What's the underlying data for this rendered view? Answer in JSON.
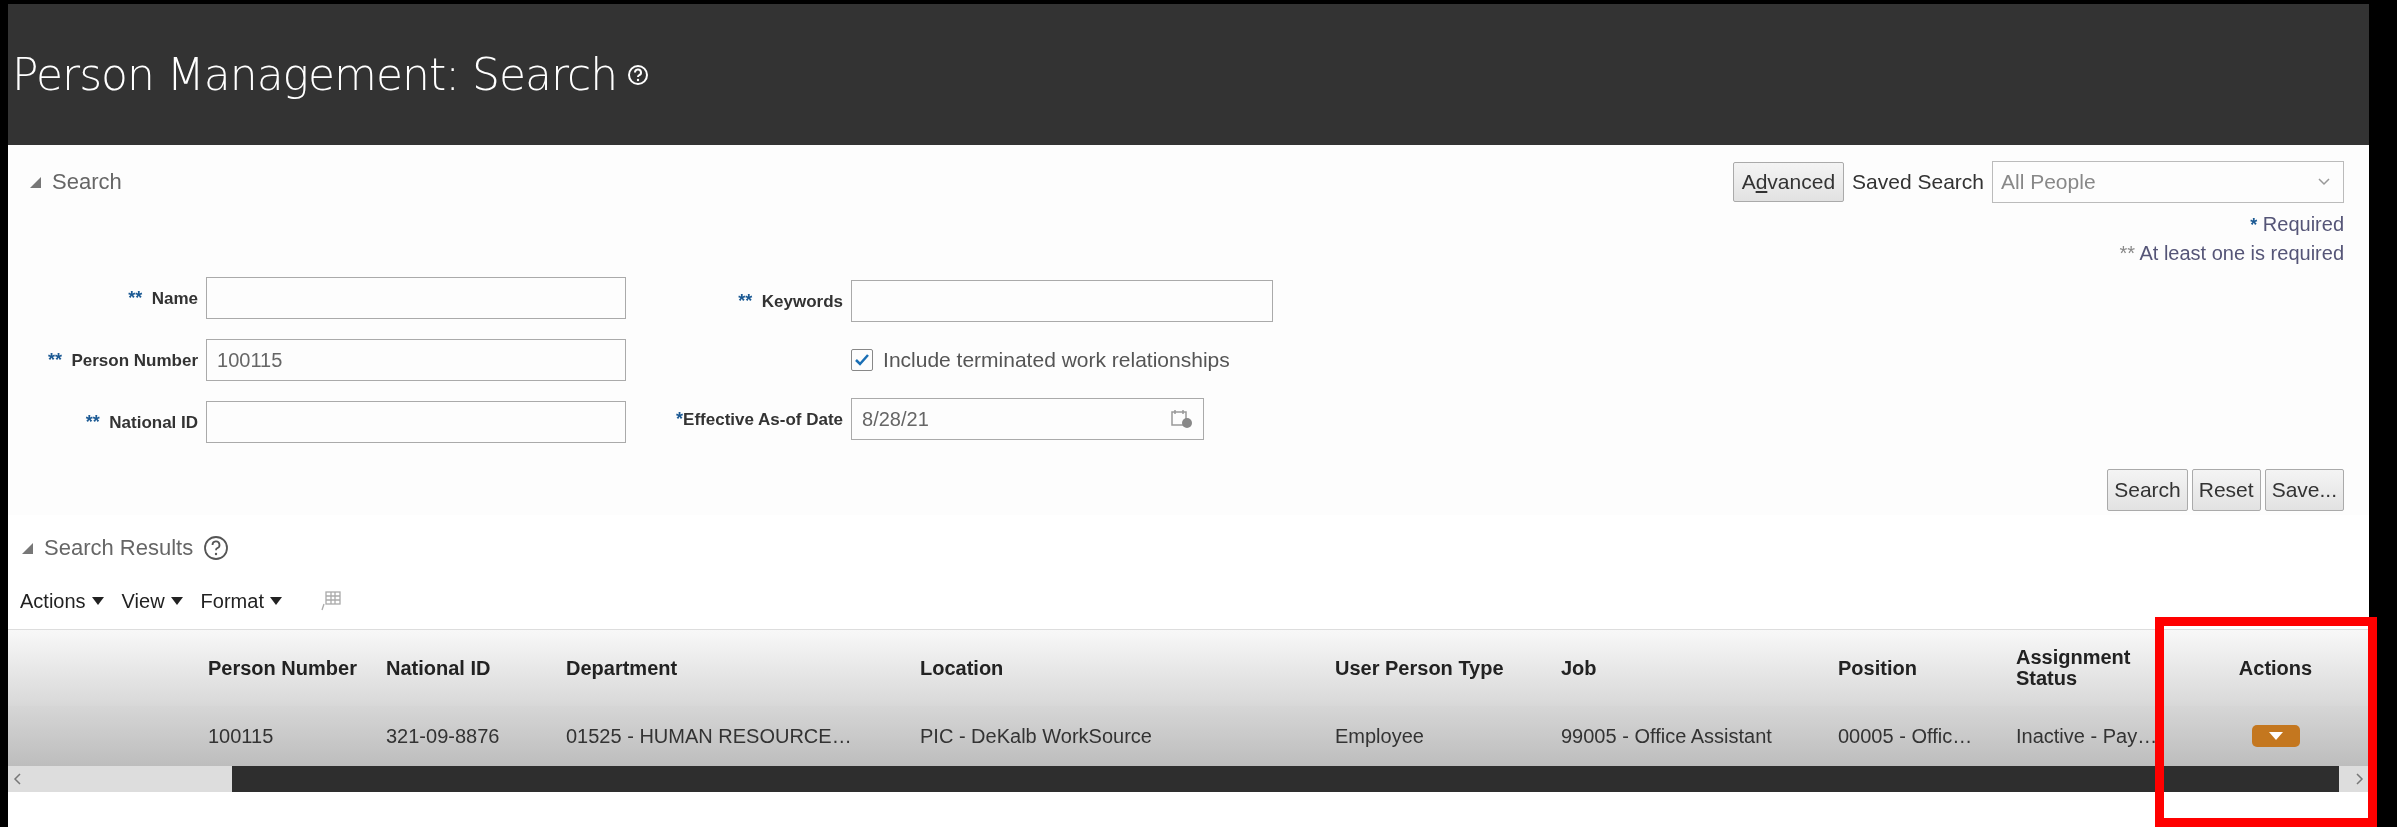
{
  "header": {
    "title": "Person Management: Search"
  },
  "search_panel": {
    "heading": "Search",
    "expanded": true,
    "advanced_button": {
      "label": "Advanced"
    },
    "saved_search": {
      "label": "Saved Search",
      "value": "All People"
    },
    "required_notes": [
      {
        "marker": "*",
        "text": "Required"
      },
      {
        "marker": "**",
        "text": "At least one is required"
      }
    ],
    "left_fields": [
      {
        "kind": "text",
        "marker": "**",
        "label": "Name"
      },
      {
        "kind": "text",
        "marker": "**",
        "label": "Person Number",
        "value": "100115"
      },
      {
        "kind": "text",
        "marker": "**",
        "label": "National ID"
      }
    ],
    "right_fields": [
      {
        "kind": "text",
        "marker": "**",
        "label": "Keywords"
      },
      {
        "kind": "checkbox",
        "label": "Include terminated work relationships",
        "checked": true
      },
      {
        "kind": "date",
        "marker": "*",
        "label": "Effective As-of Date",
        "value": "8/28/21"
      }
    ],
    "buttons": [
      "Search",
      "Reset",
      "Save..."
    ]
  },
  "results": {
    "heading": "Search Results",
    "expanded": true,
    "menus": [
      "Actions",
      "View",
      "Format"
    ],
    "columns": [
      "Person Number",
      "National ID",
      "Department",
      "Location",
      "User Person Type",
      "Job",
      "Position",
      "Assignment Status",
      "Actions"
    ],
    "rows": [
      {
        "cells": [
          "100115",
          "321-09-8876",
          "01525 - HUMAN RESOURCE…",
          "PIC - DeKalb WorkSource",
          "Employee",
          "99005 - Office Assistant",
          "00005 - Offic…",
          "Inactive - Pay…"
        ]
      }
    ]
  },
  "actions_column_highlighted": true
}
